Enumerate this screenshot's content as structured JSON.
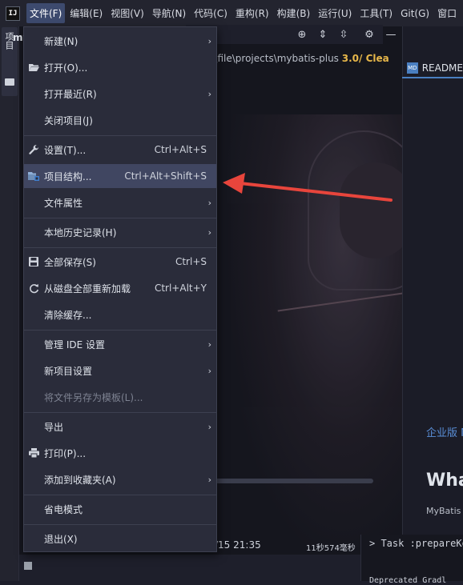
{
  "menubar": {
    "logo": "IJ",
    "items": [
      {
        "label": "文件(F)",
        "active": true
      },
      {
        "label": "编辑(E)"
      },
      {
        "label": "视图(V)"
      },
      {
        "label": "导航(N)"
      },
      {
        "label": "代码(C)"
      },
      {
        "label": "重构(R)"
      },
      {
        "label": "构建(B)"
      },
      {
        "label": "运行(U)"
      },
      {
        "label": "工具(T)"
      },
      {
        "label": "Git(G)"
      },
      {
        "label": "窗口"
      }
    ]
  },
  "sidebar": {
    "project_tab_label": "项目"
  },
  "editor": {
    "partial_title": "my",
    "path_prefix": "- D:\\file\\projects\\mybatis-plus",
    "path_version": "3.0",
    "path_suffix": "/ Clea",
    "status_time": "/15 21:35",
    "status_duration": "11秒574毫秒"
  },
  "right_panel": {
    "tab_label": "README",
    "enterprise": "企业版 M",
    "heading": "Wha",
    "subtext": "MyBatis"
  },
  "terminal": {
    "line1": "> Task :prepareKo",
    "line2": "Deprecated Gradl"
  },
  "file_menu": {
    "items": [
      {
        "label": "新建(N)",
        "submenu": true,
        "icon": ""
      },
      {
        "label": "打开(O)...",
        "icon": "folder-open-icon"
      },
      {
        "label": "打开最近(R)",
        "submenu": true
      },
      {
        "label": "关闭项目(J)"
      },
      {
        "label": "设置(T)...",
        "shortcut": "Ctrl+Alt+S",
        "icon": "wrench-icon"
      },
      {
        "label": "项目结构...",
        "shortcut": "Ctrl+Alt+Shift+S",
        "icon": "project-structure-icon",
        "selected": true
      },
      {
        "label": "文件属性",
        "submenu": true
      },
      {
        "label": "本地历史记录(H)",
        "submenu": true
      },
      {
        "label": "全部保存(S)",
        "shortcut": "Ctrl+S",
        "icon": "save-icon"
      },
      {
        "label": "从磁盘全部重新加载",
        "shortcut": "Ctrl+Alt+Y",
        "icon": "reload-icon"
      },
      {
        "label": "清除缓存..."
      },
      {
        "label": "管理 IDE 设置",
        "submenu": true
      },
      {
        "label": "新项目设置",
        "submenu": true
      },
      {
        "label": "将文件另存为模板(L)...",
        "disabled": true
      },
      {
        "label": "导出",
        "submenu": true
      },
      {
        "label": "打印(P)...",
        "icon": "print-icon"
      },
      {
        "label": "添加到收藏夹(A)",
        "submenu": true
      },
      {
        "label": "省电模式"
      },
      {
        "label": "退出(X)"
      }
    ]
  },
  "annotation": {
    "arrow_color": "#e8453c"
  }
}
